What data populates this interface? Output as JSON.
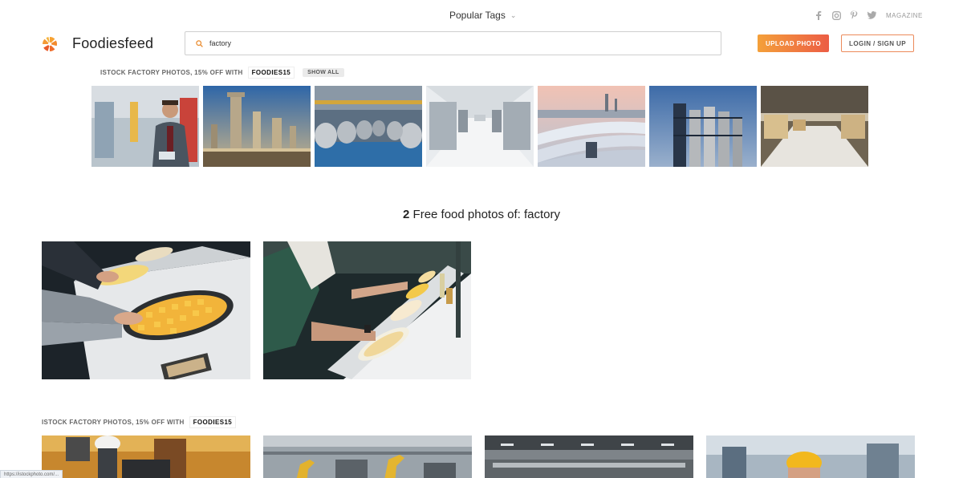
{
  "topbar": {
    "popular_tags_label": "Popular Tags",
    "socials": [
      "facebook-icon",
      "instagram-icon",
      "pinterest-icon",
      "twitter-icon"
    ],
    "magazine_label": "MAGAZINE"
  },
  "header": {
    "brand": "Foodiesfeed",
    "search_value": "factory",
    "upload_label": "UPLOAD PHOTO",
    "login_label": "LOGIN / SIGN UP"
  },
  "promo_top": {
    "text": "ISTOCK FACTORY PHOTOS, 15% OFF WITH",
    "code": "FOODIES15",
    "show_all_label": "SHOW ALL"
  },
  "results": {
    "count": "2",
    "title_rest": "Free food photos of: factory"
  },
  "promo_bottom": {
    "text": "ISTOCK FACTORY PHOTOS, 15% OFF WITH",
    "code": "FOODIES15"
  },
  "status_url": "https://istockphoto.com/...",
  "colors": {
    "accent_orange": "#f4a03a",
    "accent_red": "#ec5d45"
  }
}
